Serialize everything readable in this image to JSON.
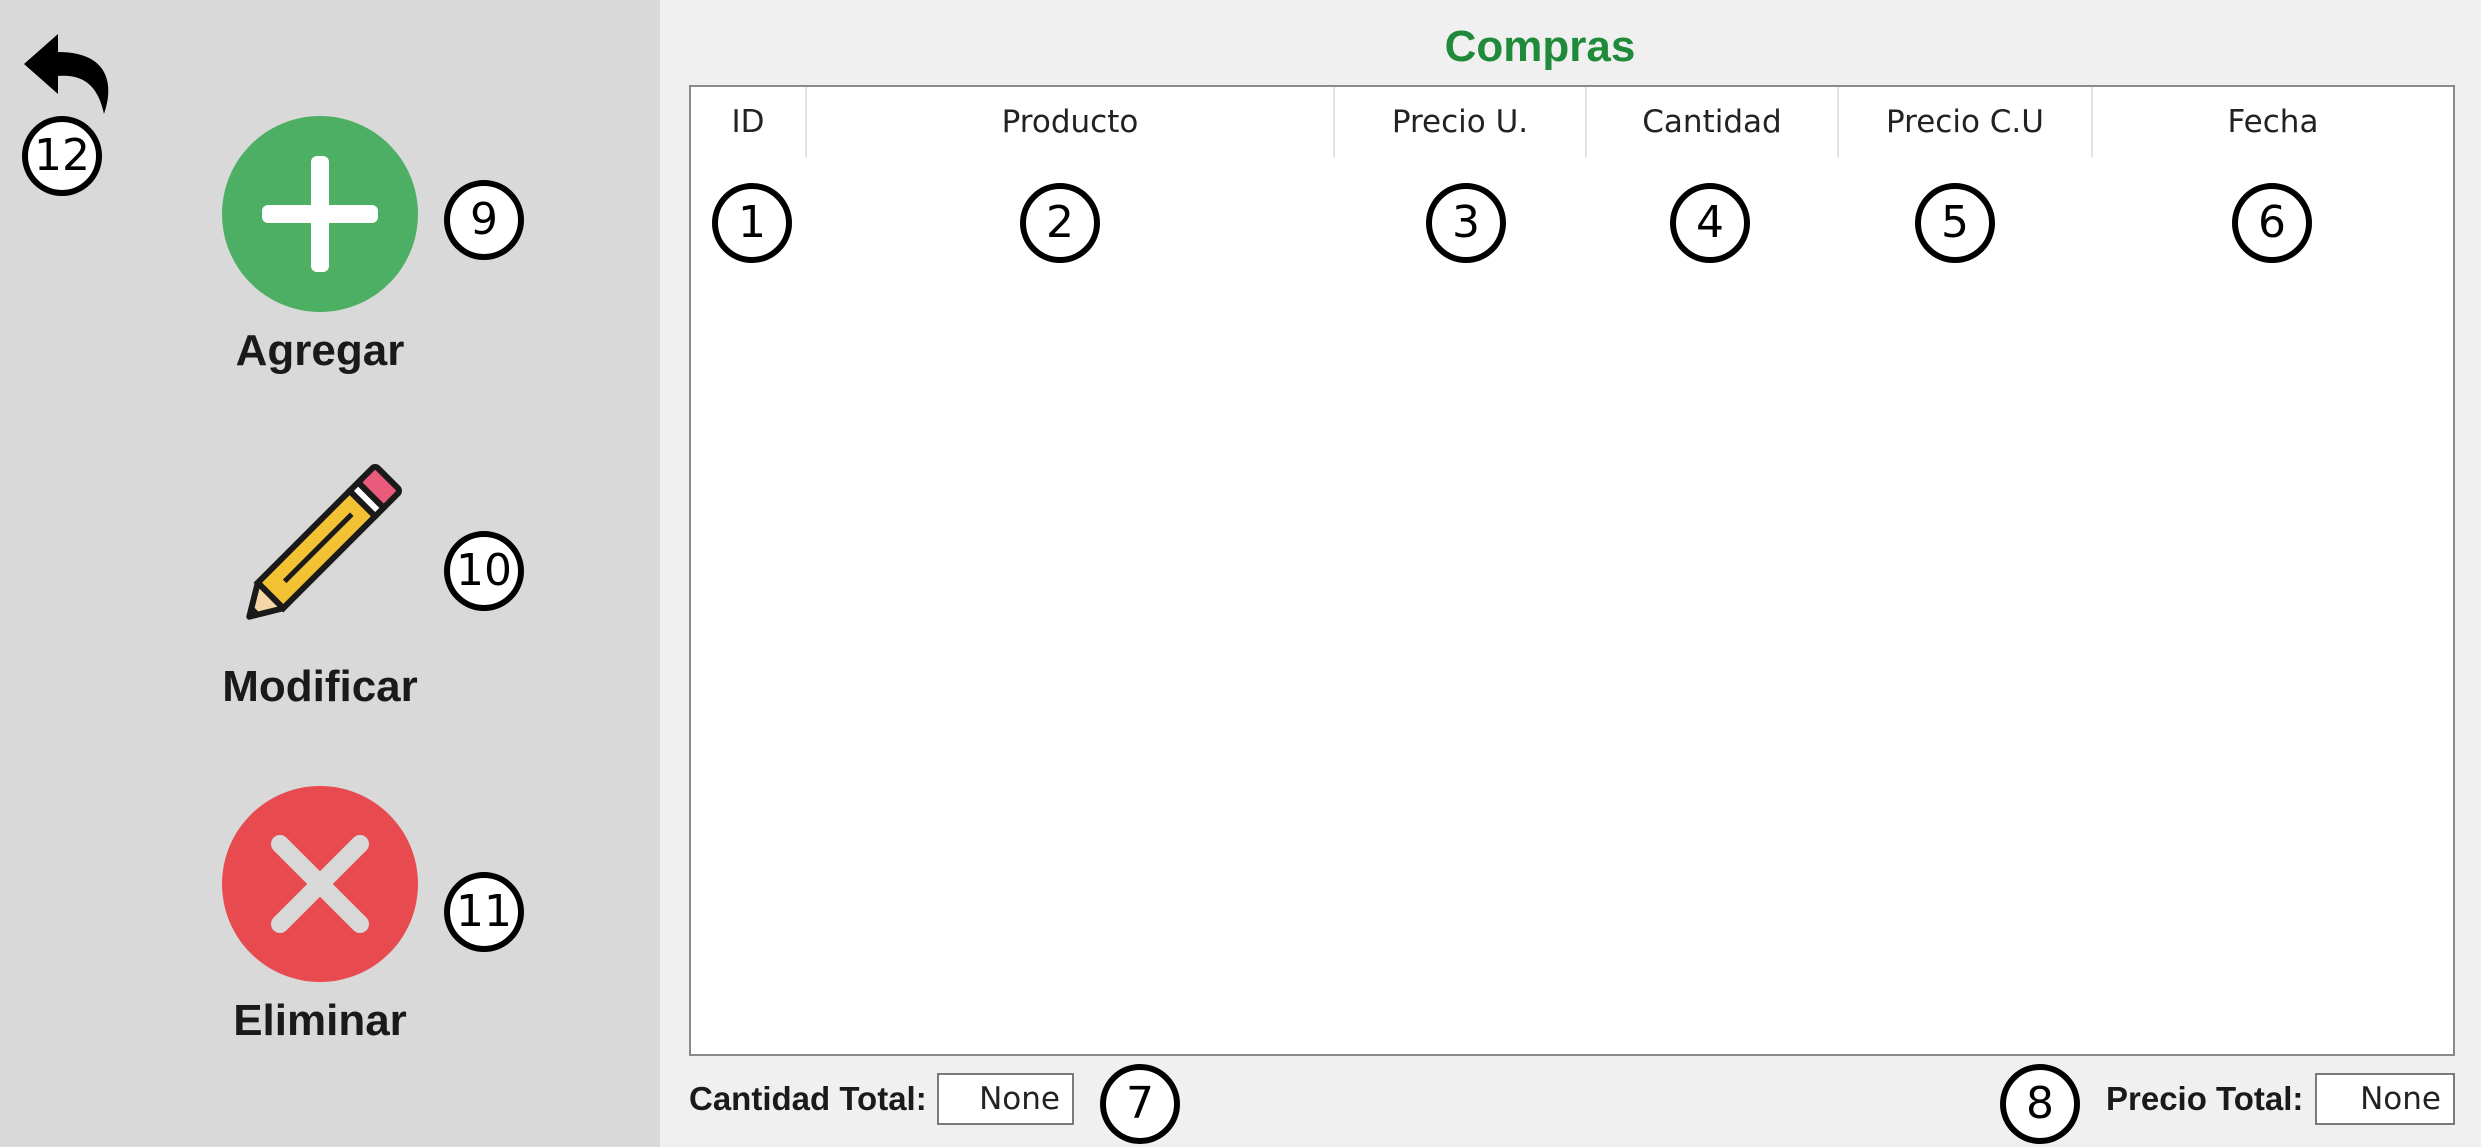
{
  "sidebar": {
    "back_icon": "undo-arrow-icon",
    "actions": [
      {
        "label": "Agregar",
        "icon": "plus-circle-icon",
        "color": "#4caf64"
      },
      {
        "label": "Modificar",
        "icon": "pencil-icon",
        "color": "#f2c234"
      },
      {
        "label": "Eliminar",
        "icon": "x-circle-icon",
        "color": "#e84b4f"
      }
    ]
  },
  "main": {
    "title": "Compras",
    "title_color": "#1f8a3a",
    "table": {
      "columns": [
        "ID",
        "Producto",
        "Precio U.",
        "Cantidad",
        "Precio C.U",
        "Fecha"
      ],
      "rows": []
    },
    "footer": {
      "cantidad_label": "Cantidad Total:",
      "cantidad_value": "None",
      "precio_label": "Precio Total:",
      "precio_value": "None"
    }
  },
  "annotations": [
    "1",
    "2",
    "3",
    "4",
    "5",
    "6",
    "7",
    "8",
    "9",
    "10",
    "11",
    "12"
  ]
}
